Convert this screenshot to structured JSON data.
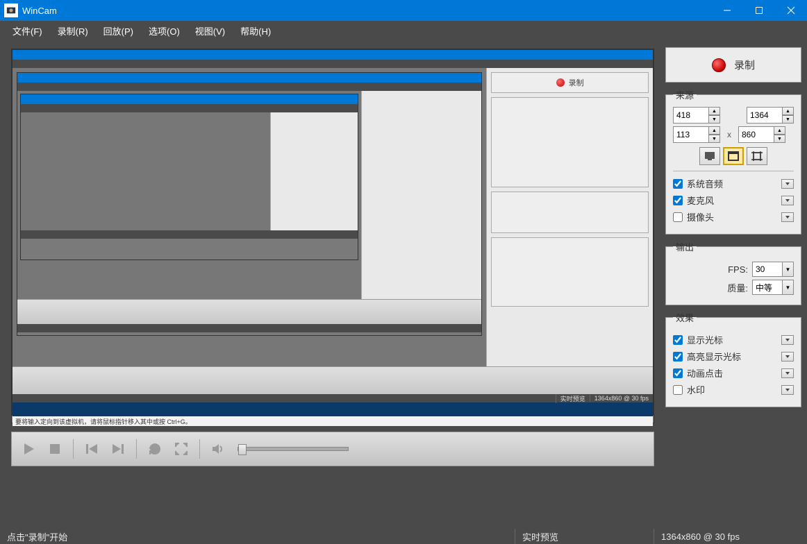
{
  "window": {
    "title": "WinCam"
  },
  "menu": {
    "file": "文件(F)",
    "record": "录制(R)",
    "playback": "回放(P)",
    "options": "选项(O)",
    "view": "视图(V)",
    "help": "帮助(H)"
  },
  "record_button": {
    "label": "录制"
  },
  "source": {
    "legend": "来源",
    "width": "418",
    "height": "1364",
    "x_offset": "113",
    "y_offset": "860",
    "separator": "x",
    "modes": {
      "fullscreen": "fullscreen",
      "window": "window",
      "region": "region",
      "selected": "window"
    },
    "system_audio": {
      "label": "系统音频",
      "checked": true
    },
    "microphone": {
      "label": "麦克风",
      "checked": true
    },
    "camera": {
      "label": "摄像头",
      "checked": false
    }
  },
  "output": {
    "legend": "输出",
    "fps_label": "FPS:",
    "fps_value": "30",
    "quality_label": "质量:",
    "quality_value": "中等"
  },
  "effects": {
    "legend": "效果",
    "show_cursor": {
      "label": "显示光标",
      "checked": true
    },
    "highlight_cursor": {
      "label": "高亮显示光标",
      "checked": true
    },
    "animate_click": {
      "label": "动画点击",
      "checked": true
    },
    "watermark": {
      "label": "水印",
      "checked": false
    }
  },
  "status": {
    "hint": "点击\"录制\"开始",
    "preview_label": "实时预览",
    "dimensions": "1364x860 @ 30 fps"
  },
  "preview": {
    "nested_status_dims": "1364x860 @ 30 fps",
    "nested_status_preview": "实时预览"
  }
}
